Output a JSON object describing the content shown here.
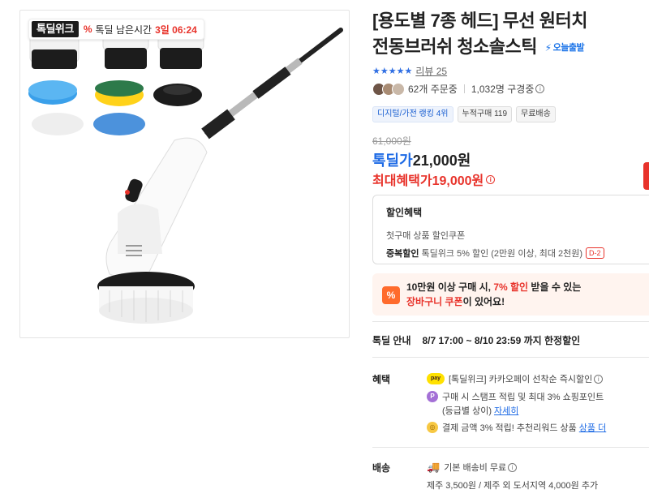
{
  "badge": {
    "logo": "톡딜위크",
    "percent_icon": "%",
    "text": "톡딜 남은시간",
    "time": "3일 06:24"
  },
  "product": {
    "title_line1": "[용도별 7종 헤드] 무선 원터치",
    "title_line2": "전동브러쉬 청소솔스틱",
    "ship_badge": "오늘출발",
    "review": "리뷰 25",
    "orders": "62개 주문중",
    "viewers": "1,032명 구경중",
    "chips": [
      "디지털/가전 랭킹 4위",
      "누적구매 119",
      "무료배송"
    ],
    "original_price": "61,000원",
    "deal_label": "톡딜가",
    "deal_price": "21,000원",
    "max_label": "최대혜택가",
    "max_price": "19,000원"
  },
  "discount": {
    "heading": "할인혜택",
    "line1": "첫구매 상품 할인쿠폰",
    "line2_bold": "중복할인",
    "line2": "톡딜위크 5% 할인 (2만원 이상, 최대 2천원)",
    "line2_badge": "D-2"
  },
  "coupon": {
    "icon": "%",
    "line1_a": "10만원 이상 구매 시,",
    "line1_red": "7% 할인",
    "line1_b": "받을 수 있는",
    "line2_red": "장바구니 쿠폰",
    "line2_b": "이 있어요!"
  },
  "notice": {
    "label": "톡딜 안내",
    "text": "8/7 17:00 ~ 8/10 23:59 까지 한정할인"
  },
  "benefits": {
    "label": "혜택",
    "items": [
      {
        "icon_text": "pay",
        "text": "[톡딜위크] 카카오페이 선착순 즉시할인"
      },
      {
        "icon_text": "P",
        "text": "구매 시 스탬프 적립 및 최대 3% 쇼핑포인트"
      },
      {
        "text": "(등급별 상이)",
        "link": "자세히"
      },
      {
        "icon_text": "◎",
        "text": "결제 금액 3% 적립! 추천리워드 상품",
        "link": "상품 더"
      }
    ]
  },
  "shipping": {
    "label": "배송",
    "line1": "기본 배송비 무료",
    "line2": "제주 3,500원 / 제주 외 도서지역 4,000원 추가"
  },
  "colors": {
    "accent_red": "#e8332b",
    "accent_blue": "#1d6ae5",
    "star_blue": "#2f6ee3"
  }
}
